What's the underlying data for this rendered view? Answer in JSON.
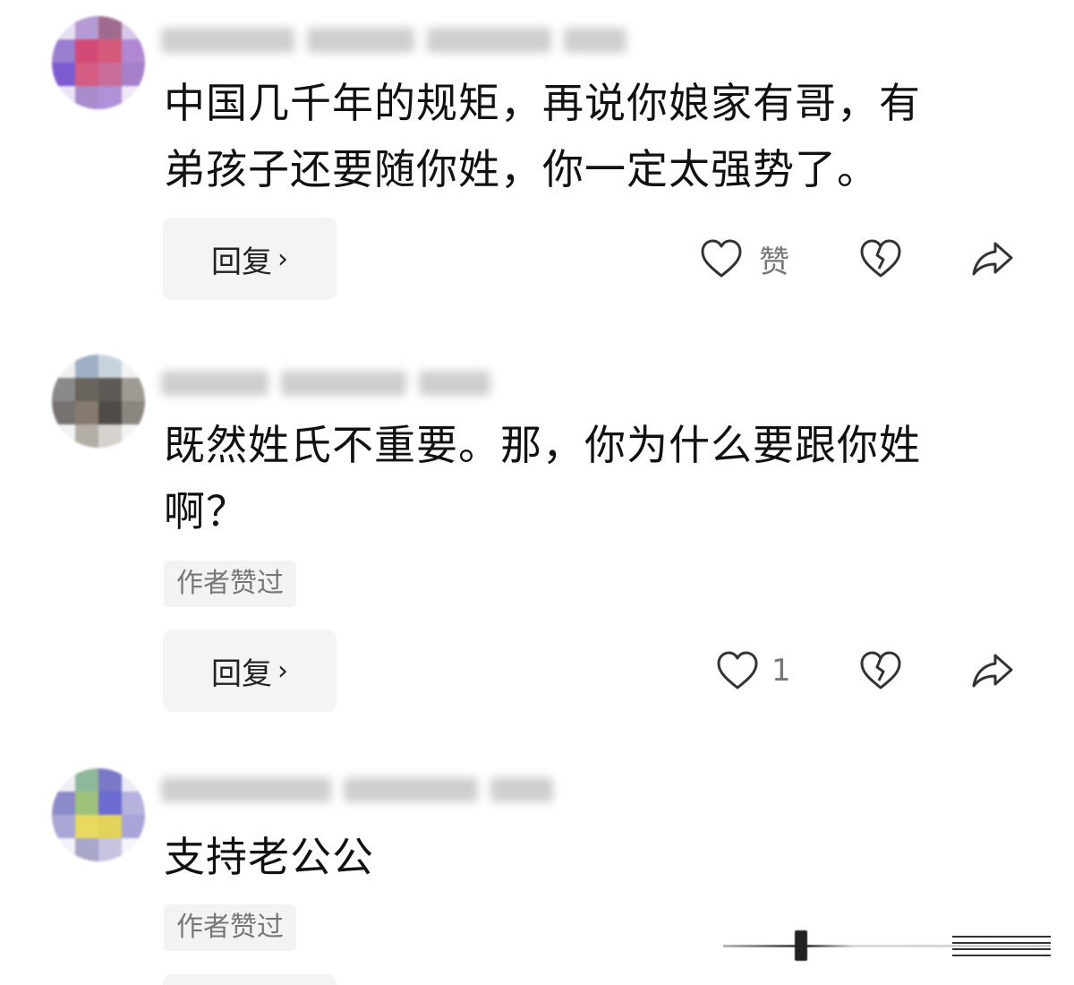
{
  "comments": [
    {
      "text": "中国几千年的规矩，再说你娘家有哥，有\n弟孩子还要随你姓，你一定太强势了。",
      "reply_label": "回复",
      "reply_chevron": "›",
      "like_label": "赞",
      "author_liked": ""
    },
    {
      "text": "既然姓氏不重要。那，你为什么要跟你姓\n啊？",
      "author_liked": "作者赞过",
      "reply_label": "回复",
      "reply_chevron": "›",
      "like_count": "1"
    },
    {
      "text": "支持老公公",
      "author_liked": "作者赞过"
    }
  ],
  "icons": {
    "like": "heart-outline-icon",
    "dislike": "broken-heart-icon",
    "share": "share-arrow-icon"
  },
  "colors": {
    "text": "#111111",
    "muted": "#777777",
    "button_bg": "#f4f4f4"
  }
}
